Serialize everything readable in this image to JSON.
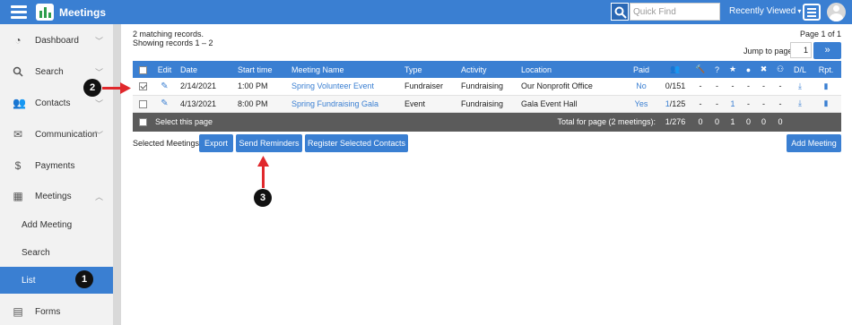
{
  "header": {
    "app_title": "Meetings",
    "quick_find_placeholder": "Quick Find",
    "recently_viewed": "Recently Viewed",
    "brand_color": "#3a7fd2"
  },
  "sidebar": {
    "items": [
      {
        "label": "Dashboard",
        "icon": "dashboard-icon"
      },
      {
        "label": "Search",
        "icon": "search-icon"
      },
      {
        "label": "Contacts",
        "icon": "users-icon"
      },
      {
        "label": "Communication",
        "icon": "envelope-icon"
      },
      {
        "label": "Payments",
        "icon": "dollar-icon"
      },
      {
        "label": "Meetings",
        "icon": "calendar-icon"
      }
    ],
    "sub_items": [
      {
        "label": "Add Meeting"
      },
      {
        "label": "Search"
      },
      {
        "label": "List"
      }
    ],
    "forms": {
      "label": "Forms",
      "icon": "document-icon"
    }
  },
  "main": {
    "matching": "2 matching records.",
    "showing": "Showing records 1 – 2",
    "page_of": "Page 1 of 1",
    "jump_label": "Jump to page",
    "jump_value": "1",
    "jump_button": "»",
    "columns": [
      "Edit",
      "Date",
      "Start time",
      "Meeting Name",
      "Type",
      "Activity",
      "Location",
      "Paid",
      "",
      "",
      "?",
      "",
      "",
      "",
      "",
      "D/L",
      "Rpt."
    ],
    "rows": [
      {
        "checked": true,
        "date": "2/14/2021",
        "start": "1:00 PM",
        "name": "Spring Volunteer Event",
        "type": "Fundraiser",
        "activity": "Fundraising",
        "location": "Our Nonprofit Office",
        "paid": "No",
        "count_a": "0",
        "count_b": "/151",
        "stats": [
          "-",
          "-",
          "-",
          "-",
          "-",
          "-"
        ]
      },
      {
        "checked": false,
        "date": "4/13/2021",
        "start": "8:00 PM",
        "name": "Spring Fundraising Gala",
        "type": "Event",
        "activity": "Fundraising",
        "location": "Gala Event Hall",
        "paid": "Yes",
        "count_a": "1",
        "count_b": "/125",
        "stats": [
          "-",
          "-",
          "1",
          "-",
          "-",
          "-"
        ]
      }
    ],
    "footer": {
      "select_page": "Select this page",
      "total_label": "Total for page (2 meetings):",
      "total_count": "1/276",
      "totals": [
        "0",
        "0",
        "1",
        "0",
        "0",
        "0"
      ]
    },
    "selected_label": "Selected Meetings:",
    "buttons": {
      "export": "Export",
      "send_reminders": "Send Reminders",
      "register": "Register Selected Contacts",
      "add_meeting": "Add Meeting"
    }
  },
  "callouts": [
    "1",
    "2",
    "3"
  ]
}
